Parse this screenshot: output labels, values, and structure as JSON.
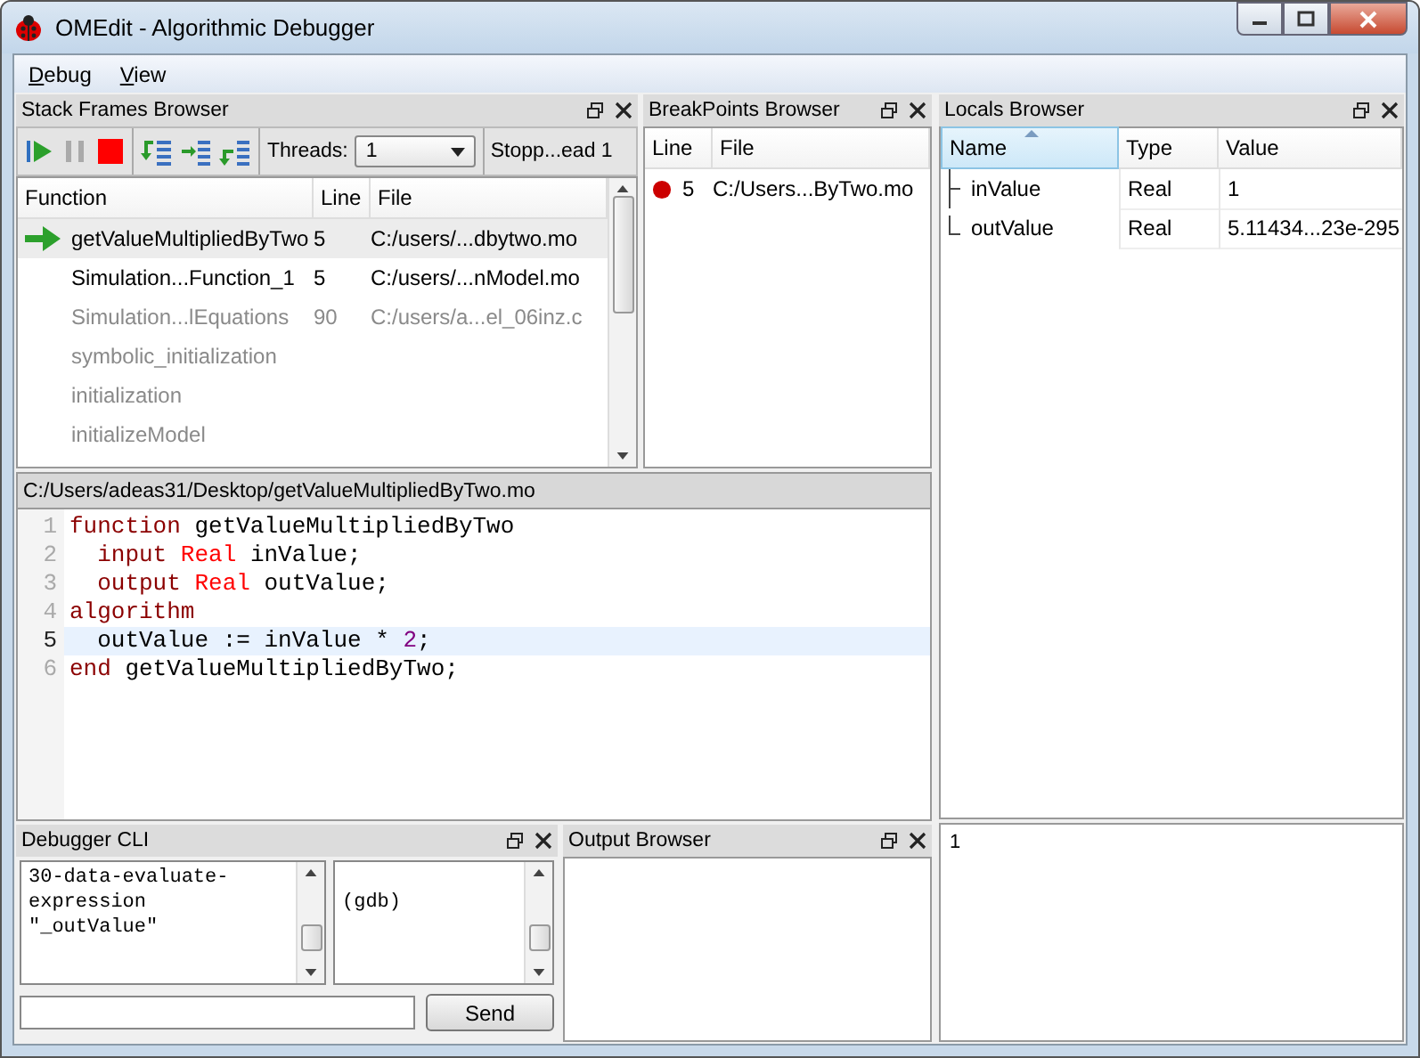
{
  "window": {
    "title": "OMEdit - Algorithmic Debugger"
  },
  "menu": [
    {
      "label": "Debug"
    },
    {
      "label": "View"
    }
  ],
  "stack_frames": {
    "title": "Stack Frames Browser",
    "threads_label": "Threads:",
    "thread": "1",
    "status": "Stopp...ead 1",
    "columns": [
      "Function",
      "Line",
      "File"
    ],
    "rows": [
      {
        "function": "getValueMultipliedByTwo",
        "line": "5",
        "file": "C:/users/...dbytwo.mo",
        "selected": true,
        "disabled": false
      },
      {
        "function": "Simulation...Function_1",
        "line": "5",
        "file": "C:/users/...nModel.mo",
        "selected": false,
        "disabled": false
      },
      {
        "function": "Simulation...lEquations",
        "line": "90",
        "file": "C:/users/a...el_06inz.c",
        "selected": false,
        "disabled": true
      },
      {
        "function": "symbolic_initialization",
        "selected": false,
        "disabled": true
      },
      {
        "function": "initialization",
        "selected": false,
        "disabled": true
      },
      {
        "function": "initializeModel",
        "selected": false,
        "disabled": true
      }
    ]
  },
  "breakpoints": {
    "title": "BreakPoints Browser",
    "columns": [
      "Line",
      "File"
    ],
    "rows": [
      {
        "line": "5",
        "file": "C:/Users...ByTwo.mo"
      }
    ]
  },
  "locals": {
    "title": "Locals Browser",
    "columns": [
      "Name",
      "Type",
      "Value"
    ],
    "rows": [
      {
        "name": "inValue",
        "type": "Real",
        "value": "1"
      },
      {
        "name": "outValue",
        "type": "Real",
        "value": "5.11434...23e-295"
      }
    ]
  },
  "editor": {
    "path": "C:/Users/adeas31/Desktop/getValueMultipliedByTwo.mo",
    "lines": [
      {
        "number": "1",
        "current": false,
        "tokens": [
          {
            "kind": "keyword",
            "text": "function"
          },
          {
            "kind": "plain",
            "text": " getValueMultipliedByTwo"
          }
        ]
      },
      {
        "number": "2",
        "current": false,
        "tokens": [
          {
            "kind": "keyword",
            "text": "  input "
          },
          {
            "kind": "type",
            "text": "Real"
          },
          {
            "kind": "plain",
            "text": " inValue;"
          }
        ]
      },
      {
        "number": "3",
        "current": false,
        "tokens": [
          {
            "kind": "keyword",
            "text": "  output "
          },
          {
            "kind": "type",
            "text": "Real"
          },
          {
            "kind": "plain",
            "text": " outValue;"
          }
        ]
      },
      {
        "number": "4",
        "current": false,
        "tokens": [
          {
            "kind": "keyword",
            "text": "algorithm"
          }
        ]
      },
      {
        "number": "5",
        "current": true,
        "tokens": [
          {
            "kind": "plain",
            "text": "  outValue := inValue * "
          },
          {
            "kind": "number",
            "text": "2"
          },
          {
            "kind": "plain",
            "text": ";"
          }
        ]
      },
      {
        "number": "6",
        "current": false,
        "tokens": [
          {
            "kind": "keyword",
            "text": "end"
          },
          {
            "kind": "plain",
            "text": " getValueMultipliedByTwo;"
          }
        ]
      }
    ]
  },
  "debugger_cli": {
    "title": "Debugger CLI",
    "command_log": "30-data-evaluate-\nexpression\n\"_outValue\"",
    "response_log": "(gdb)",
    "send": "Send"
  },
  "output_browser": {
    "title": "Output Browser"
  },
  "value_viewer": {
    "text": "1"
  }
}
